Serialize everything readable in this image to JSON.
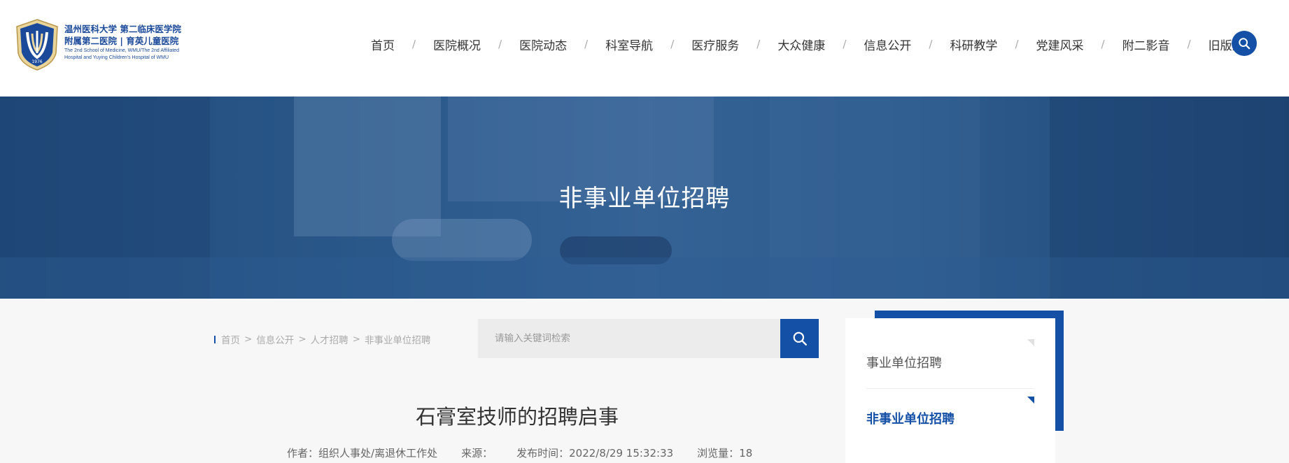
{
  "logo": {
    "line1": "温州医科大学 第二临床医学院",
    "line2": "附属第二医院 | 育英儿童医院",
    "line3": "The 2nd School of Medicine, WMU/The 2nd Affiliated",
    "line4": "Hospital and Yuying Children's Hospital of WMU",
    "year": "1976"
  },
  "nav": {
    "items": [
      "首页",
      "医院概况",
      "医院动态",
      "科室导航",
      "医疗服务",
      "大众健康",
      "信息公开",
      "科研教学",
      "党建风采",
      "附二影音",
      "旧版入口"
    ],
    "separator": "/"
  },
  "banner": {
    "title": "非事业单位招聘"
  },
  "breadcrumb": {
    "items": [
      "首页",
      "信息公开",
      "人才招聘",
      "非事业单位招聘"
    ],
    "separator": ">"
  },
  "search": {
    "placeholder": "请输入关键词检索",
    "value": ""
  },
  "article": {
    "title": "石膏室技师的招聘启事",
    "author_label": "作者：",
    "author": "组织人事处/离退休工作处",
    "source_label": "来源：",
    "source": "",
    "date_label": "发布时间：",
    "date": "2022/8/29 15:32:33",
    "views_label": "浏览量：",
    "views": "18"
  },
  "sidebar": {
    "items": [
      {
        "label": "事业单位招聘",
        "active": false
      },
      {
        "label": "非事业单位招聘",
        "active": true
      }
    ]
  },
  "colors": {
    "brand": "#1550a7",
    "banner": "#2b5a8e"
  },
  "icons": {
    "search": "search-icon",
    "logo": "university-shield-logo"
  }
}
